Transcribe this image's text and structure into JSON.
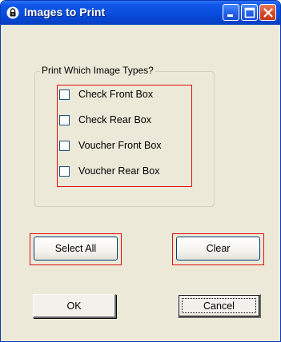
{
  "window": {
    "title": "Images to Print",
    "minimize_icon": "minimize-icon",
    "maximize_icon": "maximize-icon",
    "close_icon": "close-icon",
    "app_icon": "lock-icon"
  },
  "group": {
    "label": "Print Which Image Types?",
    "checkboxes": [
      {
        "label": "Check Front Box",
        "checked": false
      },
      {
        "label": "Check Rear Box",
        "checked": false
      },
      {
        "label": "Voucher Front Box",
        "checked": false
      },
      {
        "label": "Voucher Rear Box",
        "checked": false
      }
    ]
  },
  "buttons": {
    "select_all": "Select All",
    "clear": "Clear",
    "ok": "OK",
    "cancel": "Cancel"
  },
  "colors": {
    "highlight_frame": "#e01010",
    "titlebar": "#0a50e0",
    "dialog_face": "#ece9d8"
  }
}
